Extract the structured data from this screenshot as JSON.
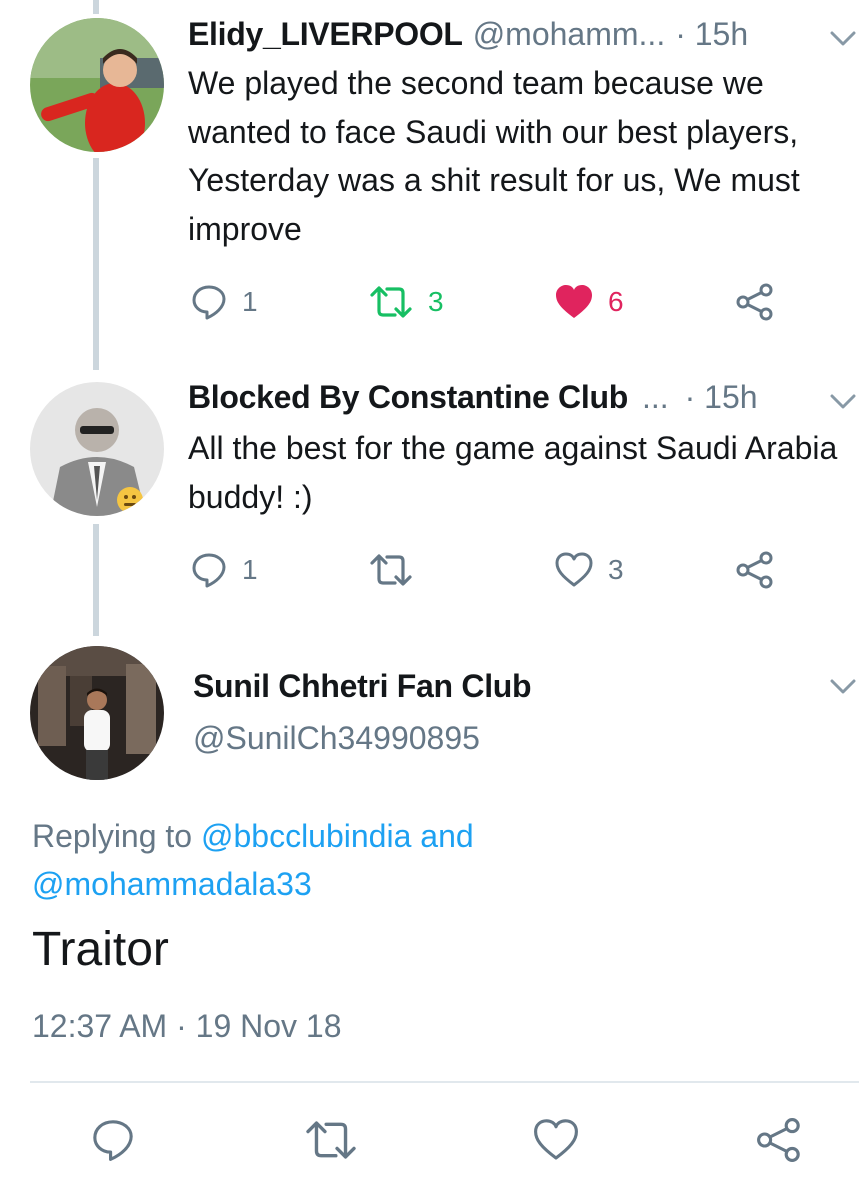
{
  "replies": [
    {
      "name": "Elidy_LIVERPOOL",
      "handle": "@mohamm...",
      "time": "· 15h",
      "text": "We played the second team because we wanted to face Saudi with our best players, Yesterday was a shit result for us, We must improve",
      "reply_count": "1",
      "retweet_count": "3",
      "like_count": "6",
      "retweeted": true,
      "liked": true
    },
    {
      "name": "Blocked By Constantine Club",
      "handle": "...",
      "time": "· 15h",
      "text": "All the best for the game against Saudi Arabia buddy! :)",
      "reply_count": "1",
      "retweet_count": "",
      "like_count": "3",
      "retweeted": false,
      "liked": false
    }
  ],
  "focused": {
    "name": "Sunil Chhetri Fan Club",
    "handle": "@SunilCh34990895",
    "replying_prefix": "Replying to",
    "reply_to_1": "@bbcclubindia",
    "reply_and": "and",
    "reply_to_2": "@mohammadala33",
    "text": "Traitor",
    "timestamp": "12:37 AM · 19 Nov 18"
  },
  "colors": {
    "accent": "#1da1f2",
    "retweet_green": "#17bf63",
    "like_red": "#e0245e",
    "secondary_text": "#657786"
  },
  "icons": [
    "reply-icon",
    "retweet-icon",
    "like-icon",
    "share-icon",
    "chevron-down-icon"
  ]
}
